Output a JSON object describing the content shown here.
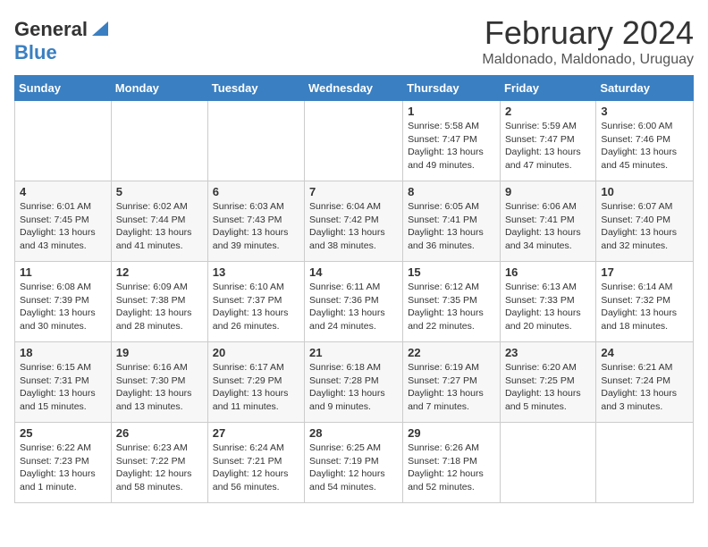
{
  "header": {
    "logo_general": "General",
    "logo_blue": "Blue",
    "title": "February 2024",
    "subtitle": "Maldonado, Maldonado, Uruguay"
  },
  "days_of_week": [
    "Sunday",
    "Monday",
    "Tuesday",
    "Wednesday",
    "Thursday",
    "Friday",
    "Saturday"
  ],
  "weeks": [
    [
      {
        "day": "",
        "info": ""
      },
      {
        "day": "",
        "info": ""
      },
      {
        "day": "",
        "info": ""
      },
      {
        "day": "",
        "info": ""
      },
      {
        "day": "1",
        "info": "Sunrise: 5:58 AM\nSunset: 7:47 PM\nDaylight: 13 hours\nand 49 minutes."
      },
      {
        "day": "2",
        "info": "Sunrise: 5:59 AM\nSunset: 7:47 PM\nDaylight: 13 hours\nand 47 minutes."
      },
      {
        "day": "3",
        "info": "Sunrise: 6:00 AM\nSunset: 7:46 PM\nDaylight: 13 hours\nand 45 minutes."
      }
    ],
    [
      {
        "day": "4",
        "info": "Sunrise: 6:01 AM\nSunset: 7:45 PM\nDaylight: 13 hours\nand 43 minutes."
      },
      {
        "day": "5",
        "info": "Sunrise: 6:02 AM\nSunset: 7:44 PM\nDaylight: 13 hours\nand 41 minutes."
      },
      {
        "day": "6",
        "info": "Sunrise: 6:03 AM\nSunset: 7:43 PM\nDaylight: 13 hours\nand 39 minutes."
      },
      {
        "day": "7",
        "info": "Sunrise: 6:04 AM\nSunset: 7:42 PM\nDaylight: 13 hours\nand 38 minutes."
      },
      {
        "day": "8",
        "info": "Sunrise: 6:05 AM\nSunset: 7:41 PM\nDaylight: 13 hours\nand 36 minutes."
      },
      {
        "day": "9",
        "info": "Sunrise: 6:06 AM\nSunset: 7:41 PM\nDaylight: 13 hours\nand 34 minutes."
      },
      {
        "day": "10",
        "info": "Sunrise: 6:07 AM\nSunset: 7:40 PM\nDaylight: 13 hours\nand 32 minutes."
      }
    ],
    [
      {
        "day": "11",
        "info": "Sunrise: 6:08 AM\nSunset: 7:39 PM\nDaylight: 13 hours\nand 30 minutes."
      },
      {
        "day": "12",
        "info": "Sunrise: 6:09 AM\nSunset: 7:38 PM\nDaylight: 13 hours\nand 28 minutes."
      },
      {
        "day": "13",
        "info": "Sunrise: 6:10 AM\nSunset: 7:37 PM\nDaylight: 13 hours\nand 26 minutes."
      },
      {
        "day": "14",
        "info": "Sunrise: 6:11 AM\nSunset: 7:36 PM\nDaylight: 13 hours\nand 24 minutes."
      },
      {
        "day": "15",
        "info": "Sunrise: 6:12 AM\nSunset: 7:35 PM\nDaylight: 13 hours\nand 22 minutes."
      },
      {
        "day": "16",
        "info": "Sunrise: 6:13 AM\nSunset: 7:33 PM\nDaylight: 13 hours\nand 20 minutes."
      },
      {
        "day": "17",
        "info": "Sunrise: 6:14 AM\nSunset: 7:32 PM\nDaylight: 13 hours\nand 18 minutes."
      }
    ],
    [
      {
        "day": "18",
        "info": "Sunrise: 6:15 AM\nSunset: 7:31 PM\nDaylight: 13 hours\nand 15 minutes."
      },
      {
        "day": "19",
        "info": "Sunrise: 6:16 AM\nSunset: 7:30 PM\nDaylight: 13 hours\nand 13 minutes."
      },
      {
        "day": "20",
        "info": "Sunrise: 6:17 AM\nSunset: 7:29 PM\nDaylight: 13 hours\nand 11 minutes."
      },
      {
        "day": "21",
        "info": "Sunrise: 6:18 AM\nSunset: 7:28 PM\nDaylight: 13 hours\nand 9 minutes."
      },
      {
        "day": "22",
        "info": "Sunrise: 6:19 AM\nSunset: 7:27 PM\nDaylight: 13 hours\nand 7 minutes."
      },
      {
        "day": "23",
        "info": "Sunrise: 6:20 AM\nSunset: 7:25 PM\nDaylight: 13 hours\nand 5 minutes."
      },
      {
        "day": "24",
        "info": "Sunrise: 6:21 AM\nSunset: 7:24 PM\nDaylight: 13 hours\nand 3 minutes."
      }
    ],
    [
      {
        "day": "25",
        "info": "Sunrise: 6:22 AM\nSunset: 7:23 PM\nDaylight: 13 hours\nand 1 minute."
      },
      {
        "day": "26",
        "info": "Sunrise: 6:23 AM\nSunset: 7:22 PM\nDaylight: 12 hours\nand 58 minutes."
      },
      {
        "day": "27",
        "info": "Sunrise: 6:24 AM\nSunset: 7:21 PM\nDaylight: 12 hours\nand 56 minutes."
      },
      {
        "day": "28",
        "info": "Sunrise: 6:25 AM\nSunset: 7:19 PM\nDaylight: 12 hours\nand 54 minutes."
      },
      {
        "day": "29",
        "info": "Sunrise: 6:26 AM\nSunset: 7:18 PM\nDaylight: 12 hours\nand 52 minutes."
      },
      {
        "day": "",
        "info": ""
      },
      {
        "day": "",
        "info": ""
      }
    ]
  ]
}
